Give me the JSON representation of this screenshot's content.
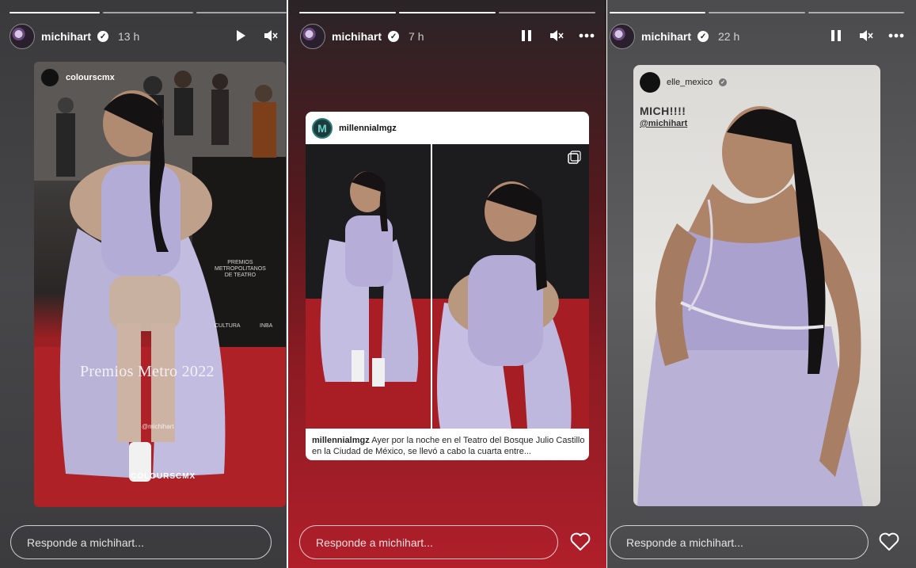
{
  "stories": [
    {
      "username": "michihart",
      "time": "13 h",
      "source_account": "colourscmx",
      "overlay_title": "Premios Metro 2022",
      "overlay_handle": "@michihart",
      "overlay_brand": "COLOURSCMX",
      "background_sign": "PREMIOS\nMETROPOLITANOS\nDE TEATRO",
      "background_sponsor_1": "CULTURA",
      "background_sponsor_2": "INBA",
      "reply_placeholder": "Responde a michihart...",
      "progress_segments": 3,
      "progress_done": 1
    },
    {
      "username": "michihart",
      "time": "7 h",
      "post_account": "millennialmgz",
      "post_logo_letter": "M",
      "caption_user": "millennialmgz",
      "caption_text": " Ayer por la noche en el Teatro del Bosque Julio Castillo en la Ciudad de México, se llevó a cabo la cuarta entre...",
      "reply_placeholder": "Responde a michihart...",
      "progress_segments": 3,
      "progress_done": 2
    },
    {
      "username": "michihart",
      "time": "22 h",
      "source_account": "elle_mexico",
      "headline": "MICH!!!!",
      "mention": "@michihart",
      "reply_placeholder": "Responde a michihart...",
      "progress_segments": 3,
      "progress_done": 1
    }
  ],
  "icons": {
    "play": "play-icon",
    "pause": "pause-icon",
    "mute": "volume-mute-icon",
    "more": "more-icon",
    "heart": "heart-icon",
    "verified": "verified-badge-icon"
  },
  "colors": {
    "panel2_accent": "#b01f2a",
    "text": "#ffffff"
  }
}
